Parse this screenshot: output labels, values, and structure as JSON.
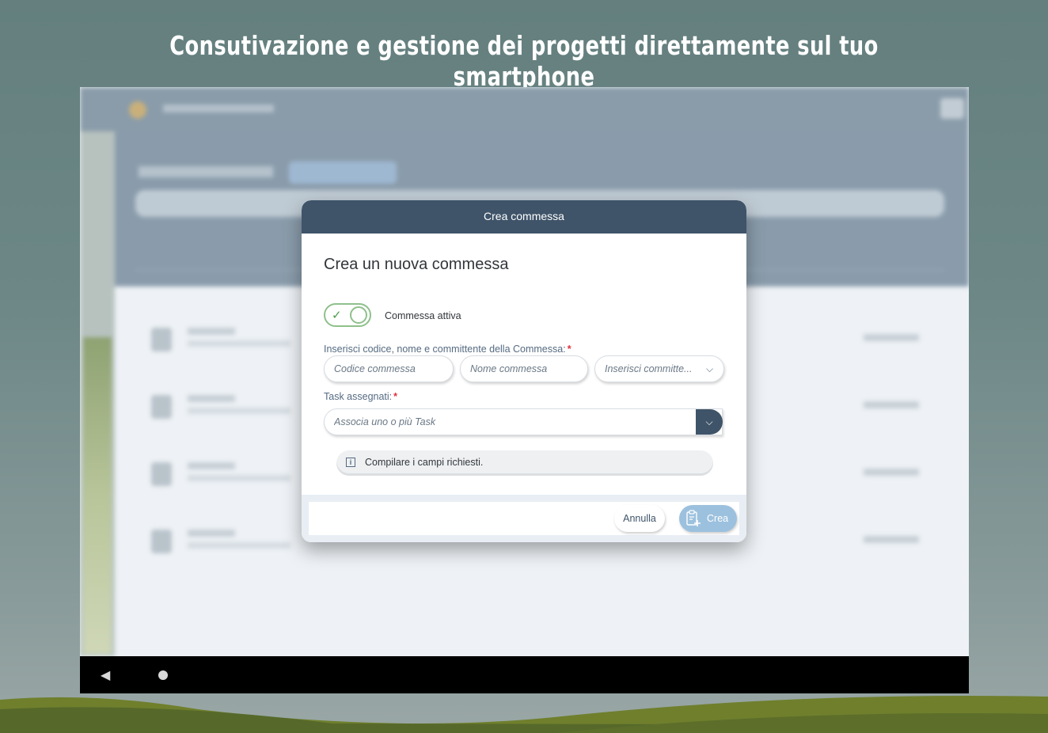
{
  "promo": {
    "title": "Consutivazione e gestione dei progetti direttamente sul tuo smartphone"
  },
  "dialog": {
    "header_title": "Crea commessa",
    "subtitle": "Crea un nuova commessa",
    "switch": {
      "state": "on",
      "label": "Commessa attiva"
    },
    "fields_label": "Inserisci codice, nome e committente della Commessa:",
    "required_marker": "*",
    "codice_placeholder": "Codice commessa",
    "nome_placeholder": "Nome commessa",
    "committente_placeholder": "Inserisci committe...",
    "task_label": "Task assegnati:",
    "task_placeholder": "Associa uno o più Task",
    "message": "Compilare i campi richiesti.",
    "cancel_label": "Annulla",
    "create_label": "Crea"
  },
  "icons": {
    "check": "check-icon",
    "chevron": "chevron-down-icon",
    "info": "info-icon",
    "clipboard_add": "clipboard-add-icon",
    "back": "back-icon",
    "home": "home-icon"
  },
  "colors": {
    "header": "#3f5469",
    "switch_on": "#8fc08b",
    "primary_button": "#9cc1de",
    "required": "#e0303e"
  }
}
